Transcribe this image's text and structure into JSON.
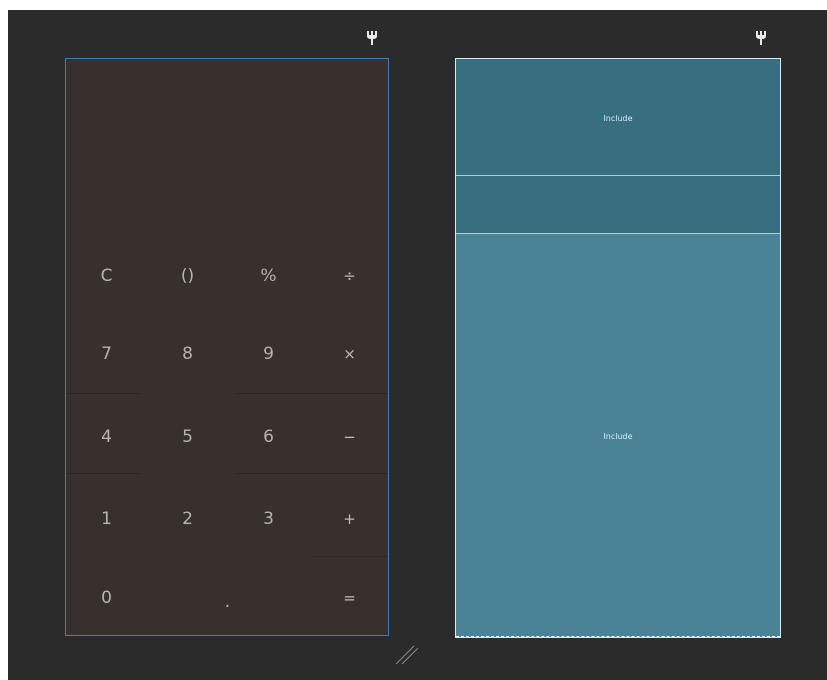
{
  "design_keypad": {
    "rows": [
      [
        "C",
        "()",
        "%",
        "÷"
      ],
      [
        "7",
        "8",
        "9",
        "×"
      ],
      [
        "4",
        "5",
        "6",
        "−"
      ],
      [
        "1",
        "2",
        "3",
        "+"
      ],
      [
        "0",
        "",
        ".",
        "="
      ]
    ]
  },
  "blueprint": {
    "top_include_label": "Include",
    "bottom_include_label": "Include"
  },
  "icons": {
    "design_toolbar": "wrench-icon",
    "blueprint_toolbar": "wrench-icon",
    "resize": "resize-handle-icon"
  },
  "colors": {
    "canvas": "#2b2b2c",
    "design_background": "#37302d",
    "design_border": "#3f7cc0",
    "blueprint_background": "#4a8395",
    "blueprint_header": "#376f81"
  }
}
